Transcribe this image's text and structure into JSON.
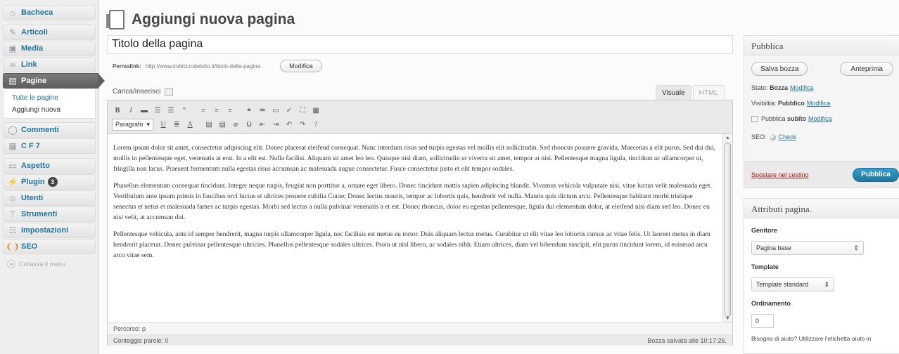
{
  "sidebar": {
    "items": [
      {
        "label": "Bacheca",
        "icon": "home-icon"
      },
      {
        "label": "Articoli",
        "icon": "pin-icon"
      },
      {
        "label": "Media",
        "icon": "media-icon"
      },
      {
        "label": "Link",
        "icon": "link-icon"
      },
      {
        "label": "Pagine",
        "icon": "pages-icon"
      },
      {
        "label": "Commenti",
        "icon": "comment-icon"
      },
      {
        "label": "C F 7",
        "icon": "form-icon"
      },
      {
        "label": "Aspetto",
        "icon": "appearance-icon"
      },
      {
        "label": "Plugin",
        "icon": "plugin-icon",
        "badge": "3"
      },
      {
        "label": "Utenti",
        "icon": "users-icon"
      },
      {
        "label": "Strumenti",
        "icon": "tools-icon"
      },
      {
        "label": "Impostazioni",
        "icon": "settings-icon"
      },
      {
        "label": "SEO",
        "icon": "seo-icon"
      }
    ],
    "submenu": [
      "Tutte le pagine",
      "Aggiungi nuova"
    ],
    "collapse_label": "Collassa il menu"
  },
  "header": {
    "title": "Aggiungi nuova pagina"
  },
  "editor": {
    "title_value": "Titolo della pagina",
    "permalink_label": "Permalink:",
    "permalink_url": "http://www.indirizzodelsito.it/titolo-della-pagina",
    "modifica_label": "Modifica",
    "upload_label": "Carica/Inserisci",
    "tabs": [
      "Visuale",
      "HTML"
    ],
    "format_select": "Paragrafo",
    "paragraphs": [
      "Lorem ipsum dolor sit amet, consectetur adipiscing elit. Donec placerat eleifend consequat. Nunc interdum risus sed turpis egestas vel mollis elit sollicitudin. Sed rhoncus posuere gravida. Maecenas a elit purus. Sed dui dui, mollis in pellentesque eget, venenatis at erat. In a elit est. Nulla facilisi. Aliquam sit amet leo leo. Quisque nisl diam, sollicitudin ut viverra sit amet, tempor at nisi. Pellentesque magna ligula, tincidunt ac ullamcorper ut, fringilla non lacus. Praesent fermentum nulla egestas risus accumsan ac malesuada augue consectetur. Fusce consectetur justo et elit tempor sodales.",
      "Phasellus elementum consequat tincidunt. Integer neque turpis, feugiat non porttitor a, ornare eget libero. Donec tincidunt mattis sapien adipiscing blandit. Vivamus vehicula vulputate nisi, vitae luctus velit malesuada eget. Vestibulum ante ipsum primis in faucibus orci luctus et ultrices posuere cubilia Curae; Donec lectus mauris, tempor ac lobortis quis, hendrerit vel nulla. Mauris quis dictum arcu. Pellentesque habitant morbi tristique senectus et netus et malesuada fames ac turpis egestas. Morbi sed lectus a nulla pulvinar venenatis a et est. Donec rhoncus, dolor eu egestas pellentesque, ligula dui elementum dolor, at eleifend nisi diam sed leo. Donec eu nisi velit, at accumsan dui.",
      "Pellentesque vehicula, ante id semper hendrerit, magna turpis ullamcorper ligula, nec facilisis est metus eu tortor. Duis aliquam lectus metus. Curabitur ut elit vitae leo lobortis cursus ac vitae felis. Ut laoreet metus in diam hendrerit placerat. Donec pulvinar pellentesque ultricies. Phasellus pellentesque sodales ultrices. Proin ut nisl libero, ac sodales nibh. Etiam ultrices, diam vel bibendum suscipit, elit purus tincidunt lorem, id euismod arcu arcu vitae sem."
    ],
    "path_label": "Percorso: p",
    "word_count": "Conteggio parole: 0",
    "saved_status": "Bozza salvata alle 10:17:26."
  },
  "publish": {
    "title": "Pubblica",
    "save_draft": "Salva bozza",
    "preview": "Anteprima",
    "status_label": "Stato:",
    "status_value": "Bozza",
    "visibility_label": "Visibilità:",
    "visibility_value": "Pubblico",
    "publish_label": "Pubblica",
    "publish_when": "subito",
    "edit_link": "Modifica",
    "seo_label": "SEO:",
    "seo_check": "Check",
    "trash": "Spostare nel cestino",
    "publish_button": "Pubblica"
  },
  "attributes": {
    "title": "Attributi pagina.",
    "parent_label": "Genitore",
    "parent_value": "Pagina base",
    "template_label": "Template",
    "template_value": "Template standard",
    "order_label": "Ordinamento",
    "order_value": "0",
    "help": "Bisogno di aiuto? Utilizzare l'etichetta aiuto in"
  },
  "colors": {
    "link": "#21759b",
    "publish_button": "#21759b",
    "trash": "#bc0b0b",
    "active_menu": "#5f5f5f"
  }
}
